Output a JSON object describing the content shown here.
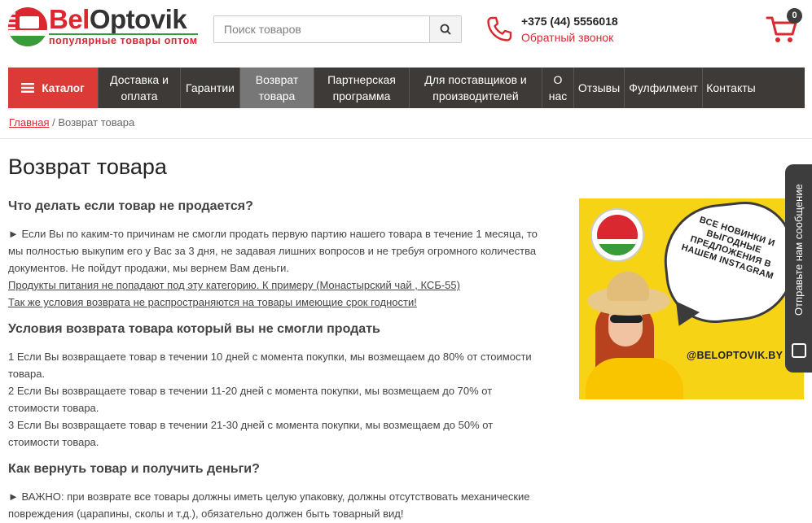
{
  "header": {
    "logo_name_part1": "Bel",
    "logo_name_part2": "Optovik",
    "logo_tagline": "популярные товары оптом",
    "search_placeholder": "Поиск товаров",
    "phone": "+375 (44) 5556018",
    "callback": "Обратный звонок",
    "cart_count": "0"
  },
  "nav": {
    "catalog": "Каталог",
    "items": [
      {
        "l1": "Доставка и",
        "l2": "оплата"
      },
      {
        "l1": "Гарантии",
        "l2": ""
      },
      {
        "l1": "Возврат",
        "l2": "товара"
      },
      {
        "l1": "Партнерская",
        "l2": "программа"
      },
      {
        "l1": "Для поставщиков и",
        "l2": "производителей"
      },
      {
        "l1": "О",
        "l2": "нас"
      },
      {
        "l1": "Отзывы",
        "l2": ""
      },
      {
        "l1": "Фулфилмент",
        "l2": ""
      },
      {
        "l1": "Контакты",
        "l2": ""
      }
    ]
  },
  "breadcrumb": {
    "home": "Главная",
    "separator": " / ",
    "current": "Возврат товара"
  },
  "page_title": "Возврат товара",
  "sections": {
    "s1_title": "Что делать если товар не продается?",
    "s1_p1": "► Если Вы по каким-то причинам не смогли продать первую партию нашего товара в течение 1 месяца, то мы полностью выкупим его у Вас за 3 дня, не задавая лишних вопросов и не требуя огромного количества документов. Не пойдут продажи, мы вернем Вам деньги.",
    "s1_link1": "Продукты питания не попадают под эту категорию. К примеру (Монастырский чай , КСБ-55)",
    "s1_link2": "Так же условия возврата не распространяются на товары имеющие срок годности!",
    "s2_title": "Условия возврата товара который вы не смогли продать",
    "s2_item1": "1 Если Вы возвращаете товар в течении 10 дней с момента покупки, мы возмещаем до 80% от стоимости товара.",
    "s2_item2": "2 Если Вы возвращаете товар в течении 11-20 дней с момента покупки, мы возмещаем до 70% от стоимости товара.",
    "s2_item3": "3 Если Вы возвращаете товар в течении 21-30 дней с момента покупки, мы возмещаем до 50% от стоимости товара.",
    "s3_title": "Как вернуть товар и получить деньги?",
    "s3_p1": "► ВАЖНО: при возврате все товары должны иметь целую упаковку, должны отсутствовать механические повреждения (царапины, сколы и т.д.), обязательно должен быть товарный вид!"
  },
  "banner": {
    "bubble_text": "ВСЕ НОВИНКИ И ВЫГОДНЫЕ ПРЕДЛОЖЕНИЯ В НАШЕМ INSTAGRAM",
    "handle": "@BELOPTOVIK.BY"
  },
  "side_tab": {
    "label": "Отправьте нам сообщение"
  },
  "colors": {
    "brand_red": "#d9282f",
    "nav_dark": "#3d3a38",
    "banner_yellow": "#f7d316"
  }
}
